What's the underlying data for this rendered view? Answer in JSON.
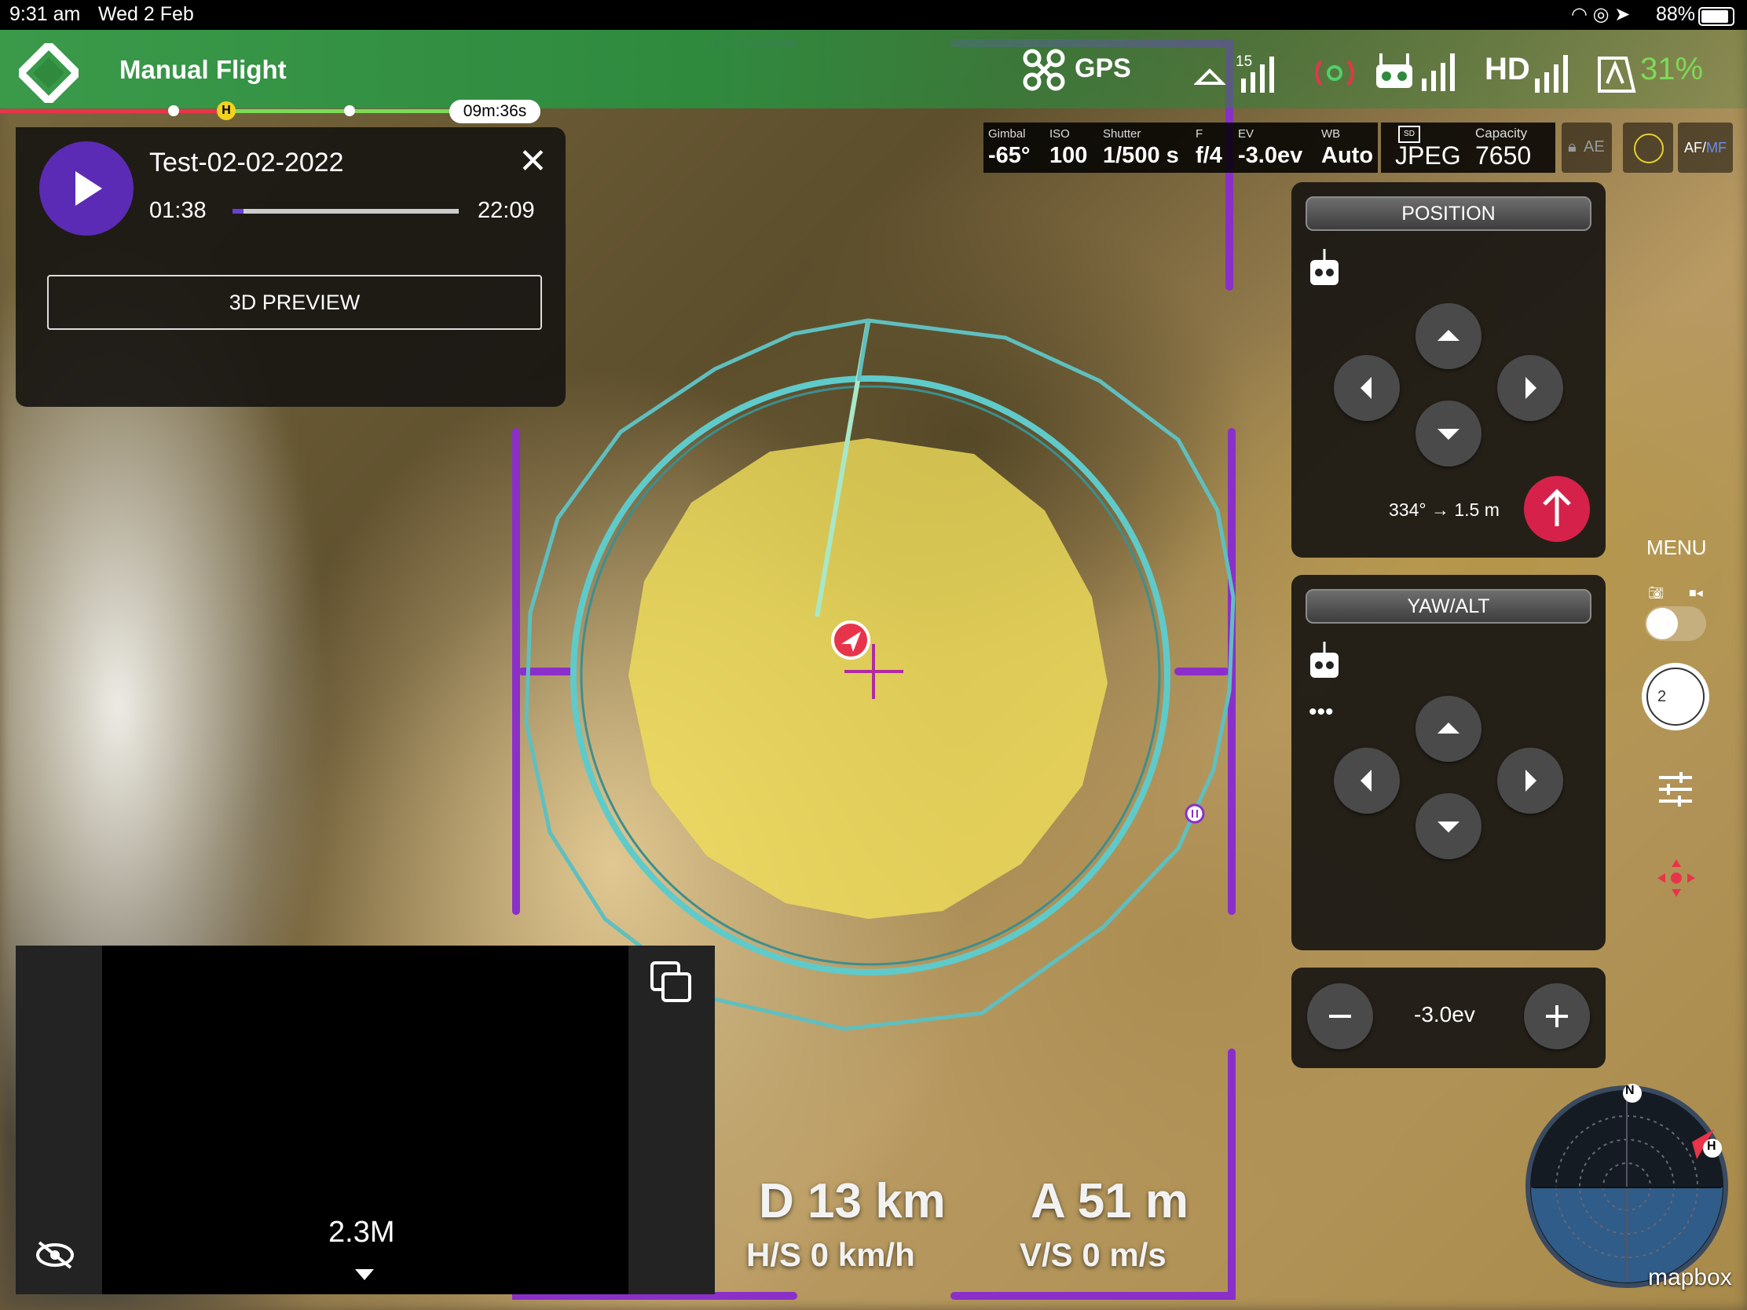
{
  "status_bar": {
    "time": "9:31 am",
    "date": "Wed 2 Feb",
    "battery": "88%"
  },
  "top_bar": {
    "title": "Manual Flight",
    "gps_label": "GPS",
    "satellites": "15",
    "hd_label": "HD",
    "drone_battery": "31%",
    "colors": {
      "accent_green": "#36a34a",
      "battery_green": "#7ed957"
    }
  },
  "timeline": {
    "remaining": "09m:36s",
    "home_marker": "H"
  },
  "playback": {
    "mission_name": "Test-02-02-2022",
    "current_time": "01:38",
    "total_time": "22:09",
    "progress": 0.05,
    "preview_button": "3D PREVIEW"
  },
  "camera": {
    "gimbal_label": "Gimbal",
    "gimbal": "-65°",
    "iso_label": "ISO",
    "iso": "100",
    "shutter_label": "Shutter",
    "shutter": "1/500 s",
    "f_label": "F",
    "f": "f/4",
    "ev_label": "EV",
    "ev": "-3.0ev",
    "wb_label": "WB",
    "wb": "Auto",
    "format": "JPEG",
    "capacity_label": "Capacity",
    "capacity": "7650",
    "ae": "AE",
    "af_label": "AF/",
    "mf_label": "MF"
  },
  "position_panel": {
    "header": "POSITION",
    "readout": "334° → 1.5 m"
  },
  "yaw_panel": {
    "header": "YAW/ALT"
  },
  "exposure_panel": {
    "value": "-3.0ev"
  },
  "right_rail": {
    "menu_label": "MENU",
    "timer_count": "2"
  },
  "telemetry": {
    "distance": "D  13 km",
    "altitude": "A  51 m",
    "hspeed": "H/S 0 km/h",
    "vspeed": "V/S 0 m/s"
  },
  "mini_view": {
    "resolution": "2.3M"
  },
  "compass": {
    "north": "N",
    "home": "H",
    "mapbox": "mapbox"
  }
}
